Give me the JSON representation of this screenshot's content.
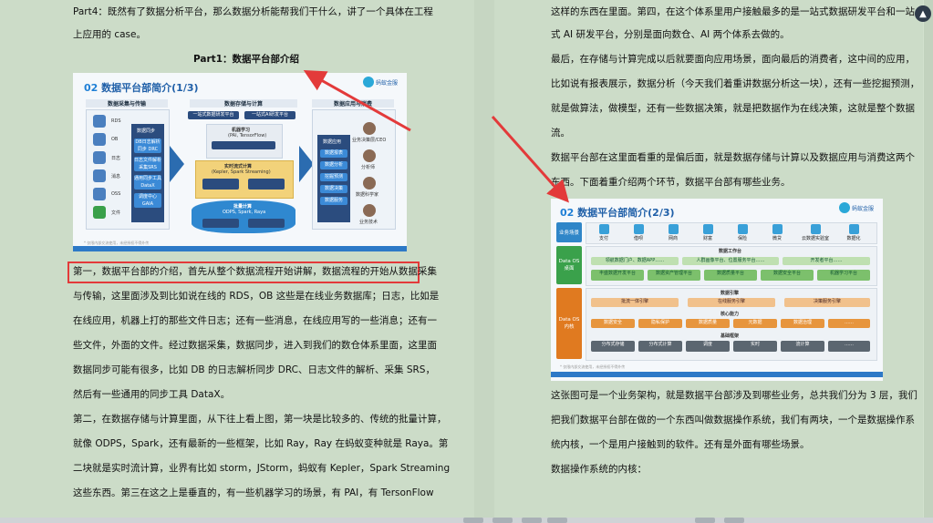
{
  "left": {
    "lines": [
      "Part4：既然有了数据分析平台，那么数据分析能帮我们干什么，讲了一个具体在工程",
      "上应用的 case。",
      "第一，数据平台部的介绍，首先从整个数据流程开始讲解，数据流程的开始从数据采集",
      "与传输，这里面涉及到比如说在线的 RDS，OB 这些是在线业务数据库；日志，比如是",
      "在线应用，机器上打的那些文件日志；还有一些消息，在线应用写的一些消息；还有一",
      "些文件，外面的文件。经过数据采集，数据同步，进入到我们的数仓体系里面，这里面",
      "数据同步可能有很多，比如 DB 的日志解析同步 DRC、日志文件的解析、采集 SRS，",
      "然后有一些通用的同步工具 DataX。",
      "第二，在数据存储与计算里面，从下往上看上图，第一块是比较多的、传统的批量计算，",
      "就像 ODPS，Spark，还有最新的一些框架，比如 Ray，Ray 在蚂蚁变种就是 Raya。第",
      "二块就是实时流计算，业界有比如 storm，JStorm，蚂蚁有 Kepler，Spark Streaming",
      "这些东西。第三在这之上是垂直的，有一些机器学习的场景，有 PAI，有 TersonFlow"
    ],
    "heading": "Part1：数据平台部介绍",
    "slide1": {
      "num": "02",
      "title": "数据平台部简介(1/3)",
      "logo": "蚂蚁金服",
      "col_heads": [
        "数据采集与传输",
        "数据存储与计算",
        "数据应用与消费"
      ],
      "sources": [
        "RDS",
        "OB",
        "日志",
        "消息",
        "OSS",
        "文件"
      ],
      "sync_label": "数据同步",
      "sync_items": [
        "DB日志解析同步 DRC",
        "日志文件解析 采集SRS",
        "通用同步工具 DataX",
        "调度中心 GAIA"
      ],
      "top_chips": [
        "一站式数据研发平台",
        "一站式AI研发平台"
      ],
      "ml_label": "机器学习",
      "ml_sub": "(PAI, TensorFlow)",
      "stream_label": "实时流式计算",
      "stream_sub": "(Kepler, Spark Streaming)",
      "batch_label": "批量计算",
      "batch_sub": "ODPS, Spark, Raya",
      "app_label": "数据应用",
      "apps": [
        "数据报表",
        "数据分析",
        "挖掘预测",
        "数据决策",
        "数据服务"
      ],
      "roles": [
        "业务决策层/CEO",
        "分析师",
        "数据科学家",
        "业务技术"
      ],
      "footer": "* 仅限内部交流使用，未经授权不得外传"
    }
  },
  "right": {
    "lines_top": [
      "这样的东西在里面。第四，在这个体系里用户接触最多的是一站式数据研发平台和一站",
      "式 AI 研发平台，分别是面向数仓、AI 两个体系去做的。",
      "最后，在存储与计算完成以后就要面向应用场景，面向最后的消费者，这中间的应用，",
      "比如说有报表展示，数据分析（今天我们着重讲数据分析这一块），还有一些挖掘预测，",
      "就是做算法，做模型，还有一些数据决策，就是把数据作为在线决策，这就是整个数据",
      "流。",
      "数据平台部在这里面看重的是偏后面，就是数据存储与计算以及数据应用与消费这两个",
      "东西。下面着重介绍两个环节，数据平台部有哪些业务。"
    ],
    "lines_bottom": [
      "这张图可是一个业务架构，就是数据平台部涉及到哪些业务，总共我们分为 3 层，我们",
      "把我们数据平台部在做的一个东西叫做数据操作系统，我们有两块，一个是数据操作系",
      "统内核，一个是用户接触到的软件。还有是外面有哪些场景。",
      "数据操作系统的内核："
    ],
    "slide2": {
      "num": "02",
      "title": "数据平台部简介(2/3)",
      "logo": "蚂蚁金服",
      "band_scene": "业务场景",
      "band_desktop": "Data OS 桌面",
      "band_kernel": "Data OS 内核",
      "scenes": [
        "支付",
        "借呗",
        "网商",
        "财富",
        "保险",
        "微贷",
        "云数据实验室",
        "数据化"
      ],
      "workbench": "数据工作台",
      "workbench_rows": [
        "领航数据门户、数据APP……",
        "人群画像平台、位置服务平台……",
        "开发者平台……"
      ],
      "workbench_tools": [
        "丰盛数据开发平台",
        "数据资产管理平台",
        "数据质量平台",
        "数据安全平台",
        "机器学习平台"
      ],
      "engine": "数据引擎",
      "engine_items": [
        "批流一体引擎",
        "在线服务引擎",
        "决策服务引擎"
      ],
      "core": "核心能力",
      "core_items": [
        "数据安全",
        "隐私保护",
        "数据质量",
        "元数据",
        "数据治理",
        "……"
      ],
      "infra": "基础框架",
      "infra_items": [
        "分布式存储",
        "分布式计算",
        "调度",
        "实时",
        "流计算",
        "……"
      ],
      "footer": "* 仅限内部交流使用，未经授权不得外传"
    }
  },
  "colors": {
    "background": "#cfdfcb",
    "highlight": "#e33a3a",
    "accent": "#1f5fa8"
  }
}
